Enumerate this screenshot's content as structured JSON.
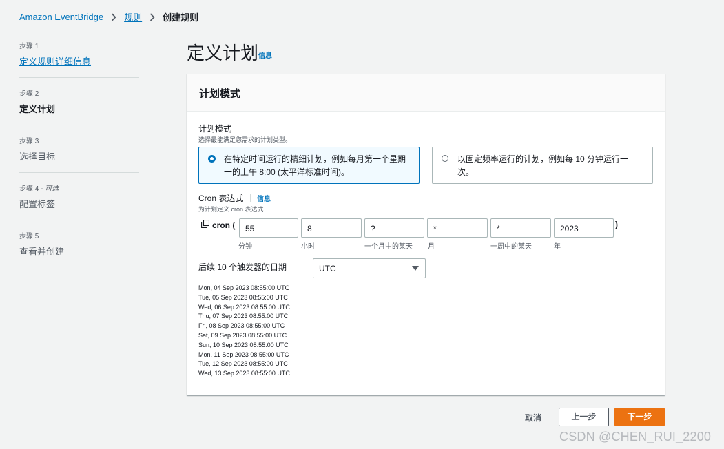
{
  "breadcrumb": {
    "root": "Amazon EventBridge",
    "rules": "规则",
    "current": "创建规则"
  },
  "steps": [
    {
      "num": "步骤 1",
      "optional": "",
      "title": "定义规则详细信息",
      "state": "link"
    },
    {
      "num": "步骤 2",
      "optional": "",
      "title": "定义计划",
      "state": "active"
    },
    {
      "num": "步骤 3",
      "optional": "",
      "title": "选择目标",
      "state": "normal"
    },
    {
      "num": "步骤 4 - ",
      "optional": "可选",
      "title": "配置标签",
      "state": "normal"
    },
    {
      "num": "步骤 5",
      "optional": "",
      "title": "查看并创建",
      "state": "normal"
    }
  ],
  "page": {
    "title": "定义计划",
    "info": "信息"
  },
  "card": {
    "header": "计划模式",
    "schedule_label": "计划模式",
    "schedule_desc": "选择最能满足您需求的计划类型。",
    "option_cron": "在特定时间运行的精细计划，例如每月第一个星期一的上午 8:00 (太平洋标准时间)。",
    "option_rate": "以固定频率运行的计划，例如每 10 分钟运行一次。",
    "selected_option": "cron",
    "cron_label": "Cron 表达式",
    "cron_info": "信息",
    "cron_desc": "为计划定义 cron 表达式",
    "cron_prefix": "cron (",
    "cron_suffix": ")",
    "cron_fields": [
      {
        "value": "55",
        "label": "分钟"
      },
      {
        "value": "8",
        "label": "小时"
      },
      {
        "value": "?",
        "label": "一个月中的某天"
      },
      {
        "value": "*",
        "label": "月"
      },
      {
        "value": "*",
        "label": "一周中的某天"
      },
      {
        "value": "2023",
        "label": "年"
      }
    ],
    "next_triggers_label": "后续 10 个触发器的日期",
    "timezone": "UTC",
    "trigger_dates": [
      "Mon, 04 Sep 2023 08:55:00 UTC",
      "Tue, 05 Sep 2023 08:55:00 UTC",
      "Wed, 06 Sep 2023 08:55:00 UTC",
      "Thu, 07 Sep 2023 08:55:00 UTC",
      "Fri, 08 Sep 2023 08:55:00 UTC",
      "Sat, 09 Sep 2023 08:55:00 UTC",
      "Sun, 10 Sep 2023 08:55:00 UTC",
      "Mon, 11 Sep 2023 08:55:00 UTC",
      "Tue, 12 Sep 2023 08:55:00 UTC",
      "Wed, 13 Sep 2023 08:55:00 UTC"
    ]
  },
  "buttons": {
    "cancel": "取消",
    "previous": "上一步",
    "next": "下一步"
  },
  "watermark": "CSDN @CHEN_RUI_2200",
  "colors": {
    "accent": "#0073bb",
    "primary_button": "#ec7211",
    "background": "#f2f3f3"
  }
}
